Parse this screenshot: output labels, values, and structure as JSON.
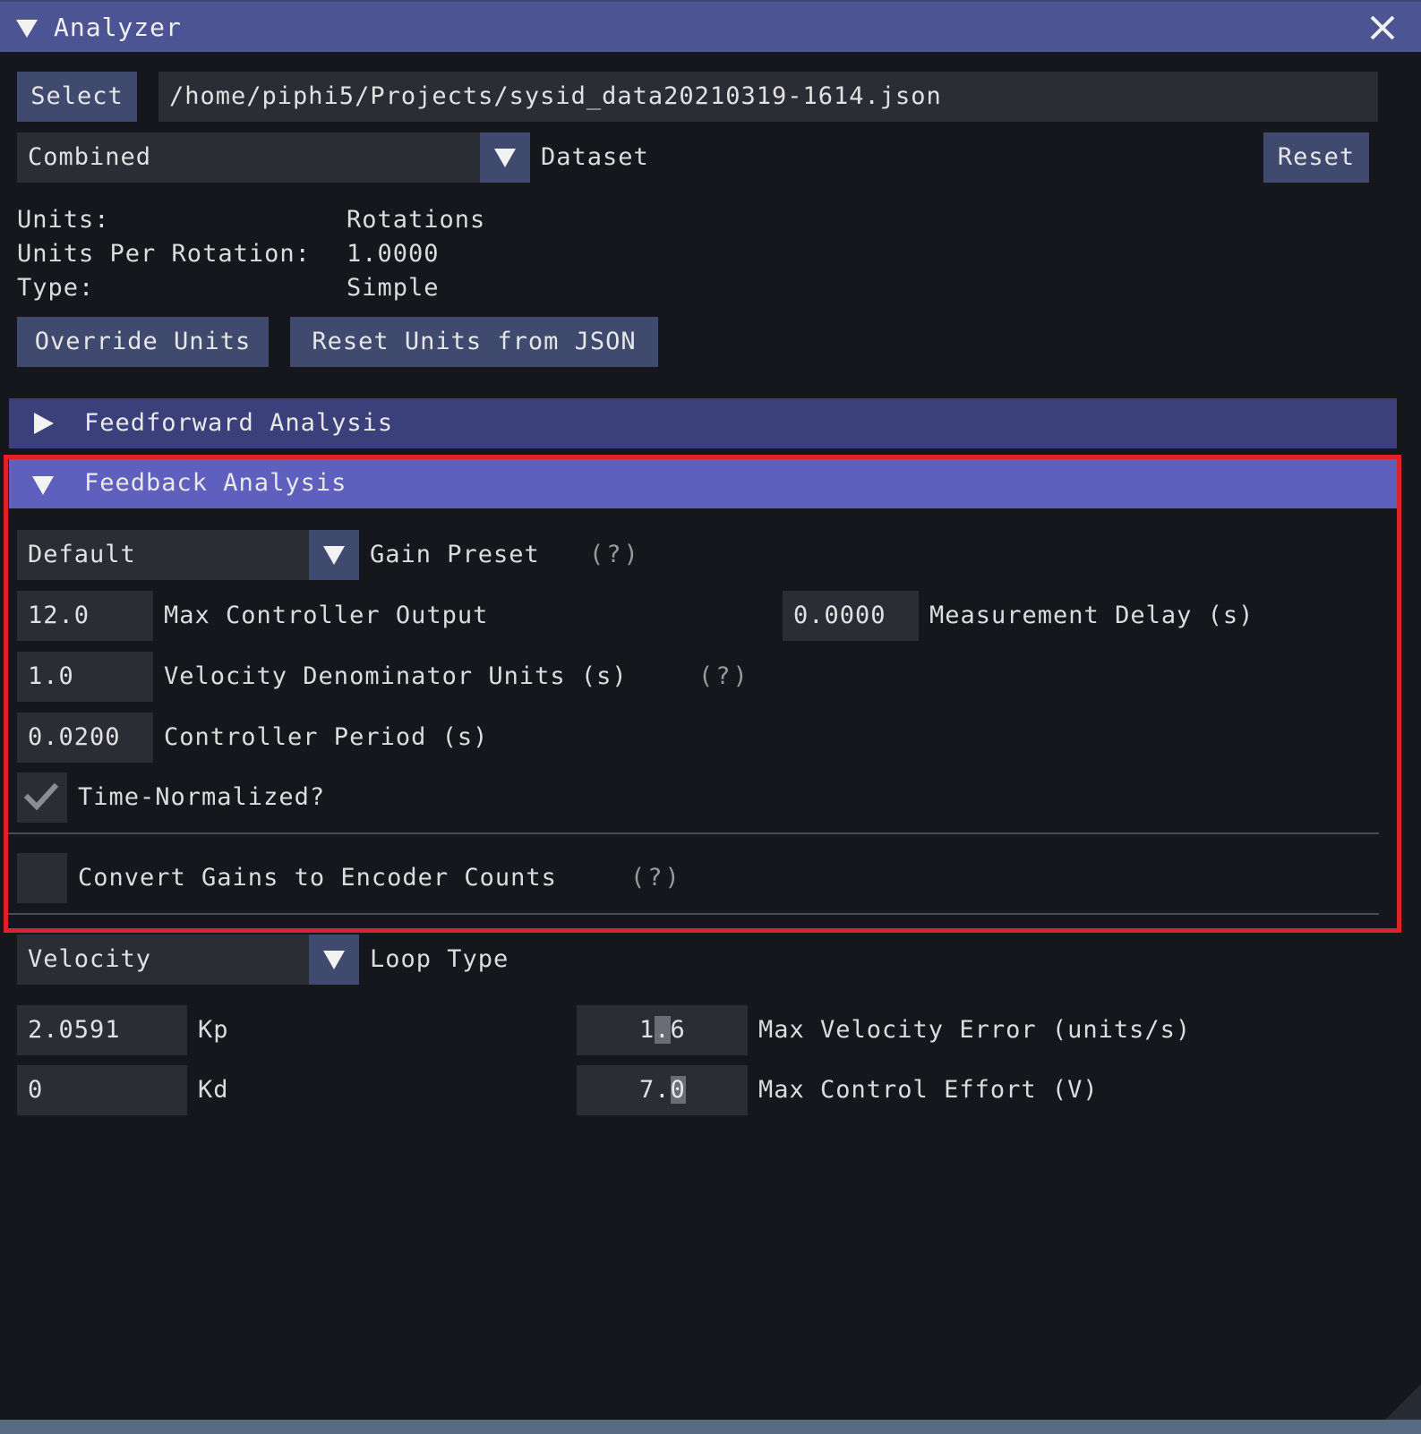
{
  "window": {
    "title": "Analyzer"
  },
  "file": {
    "select_label": "Select",
    "path": "/home/piphi5/Projects/sysid_data20210319-1614.json"
  },
  "dataset": {
    "selected": "Combined",
    "label": "Dataset",
    "reset_label": "Reset"
  },
  "info": {
    "units_label": "Units:",
    "units_value": "Rotations",
    "upr_label": "Units Per Rotation:",
    "upr_value": "1.0000",
    "type_label": "Type:",
    "type_value": "Simple"
  },
  "unit_buttons": {
    "override": "Override Units",
    "reset_json": "Reset Units from JSON"
  },
  "feedforward": {
    "title": "Feedforward Analysis"
  },
  "feedback": {
    "title": "Feedback Analysis",
    "gain_preset": {
      "selected": "Default",
      "label": "Gain Preset",
      "help": "(?)"
    },
    "max_output": {
      "value": "12.0",
      "label": "Max Controller Output"
    },
    "measurement_delay": {
      "value": "0.0000",
      "label": "Measurement Delay (s)"
    },
    "velocity_denominator": {
      "value": "1.0",
      "label": "Velocity Denominator Units (s)",
      "help": "(?)"
    },
    "controller_period": {
      "value": "0.0200",
      "label": "Controller Period (s)"
    },
    "time_normalized": {
      "label": "Time-Normalized?",
      "checked": true
    },
    "convert_gains": {
      "label": "Convert Gains to Encoder Counts",
      "help": "(?)",
      "checked": false
    }
  },
  "loop": {
    "selected": "Velocity",
    "label": "Loop Type"
  },
  "gains": {
    "kp_value": "2.0591",
    "kp_label": "Kp",
    "kd_value": "0",
    "kd_label": "Kd"
  },
  "lqr": {
    "max_vel_error_pre": "1",
    "max_vel_error_cursor": ".",
    "max_vel_error_post": "6",
    "max_vel_error_label": "Max Velocity Error (units/s)",
    "max_effort_pre": "7.",
    "max_effort_cursor": "0",
    "max_effort_label": "Max Control Effort (V)"
  },
  "colors": {
    "titlebar": "#4d5494",
    "header_collapsed": "#3b3f7a",
    "header_active": "#5f5fbd",
    "button": "#3f4a6e",
    "field": "#2a2d33",
    "window_bg": "#15171c",
    "highlight": "#e0202b"
  },
  "icons": {
    "collapse": "triangle-down",
    "expand": "triangle-right",
    "close": "x-mark",
    "check": "checkmark"
  }
}
